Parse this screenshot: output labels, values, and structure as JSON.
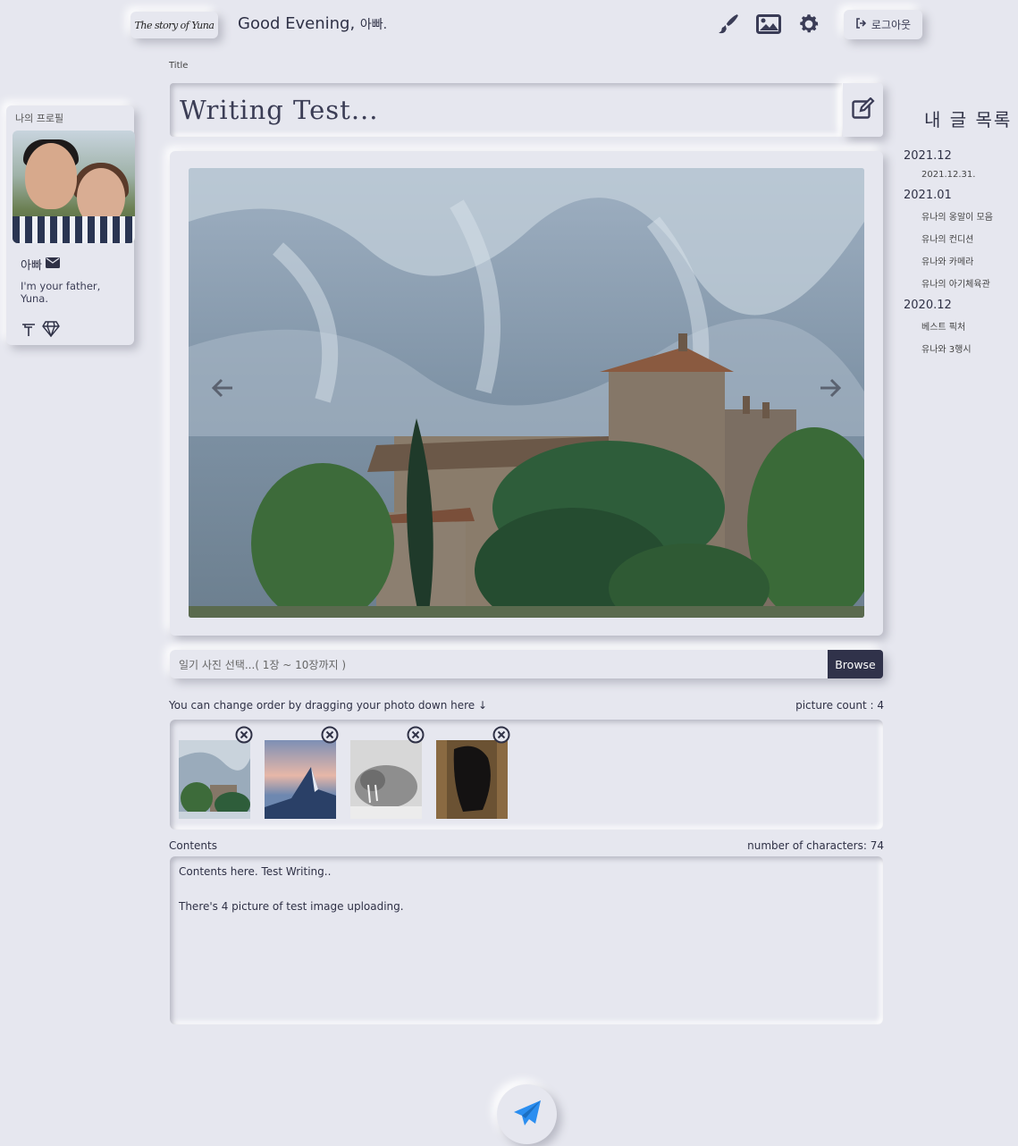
{
  "header": {
    "logo_text": "The story of Yuna",
    "greeting": "Good Evening,",
    "user_name": "아빠.",
    "icons": [
      "pen-icon",
      "image-icon",
      "gear-icon"
    ],
    "logout_label": "로그아웃"
  },
  "profile": {
    "section_label": "나의 프로필",
    "name": "아빠",
    "description": "I'm your father, Yuna.",
    "badges": [
      "tool-icon",
      "gem-icon"
    ]
  },
  "title": {
    "label": "Title",
    "value": "Writing Test..."
  },
  "file_input": {
    "placeholder": "일기 사진 선택...( 1장 ~ 10장까지 )",
    "browse_label": "Browse"
  },
  "thumbnails": {
    "drag_hint": "You can change order by dragging your photo down here ↓",
    "count_label": "picture count : 4",
    "items": [
      {
        "name": "castle"
      },
      {
        "name": "mountain-sunset"
      },
      {
        "name": "walrus"
      },
      {
        "name": "horse"
      }
    ]
  },
  "contents": {
    "label": "Contents",
    "count_label": "number of characters: 74",
    "lines": [
      "Contents here. Test Writing..",
      "",
      "There's 4 picture of test image uploading."
    ]
  },
  "my_posts": {
    "title": "내 글 목록",
    "groups": [
      {
        "month": "2021.12",
        "items": [
          "2021.12.31."
        ]
      },
      {
        "month": "2021.01",
        "items": [
          "유나의 옹알이 모음",
          "유나의 컨디션",
          "유나와 카메라",
          "유나의 아기체육관"
        ]
      },
      {
        "month": "2020.12",
        "items": [
          "베스트 픽처",
          "유나와 3행시"
        ]
      }
    ]
  },
  "colors": {
    "background": "#e6e7ef",
    "accent": "#2b8ef0",
    "text": "#3b3d55",
    "browse_bg": "#30324a"
  }
}
